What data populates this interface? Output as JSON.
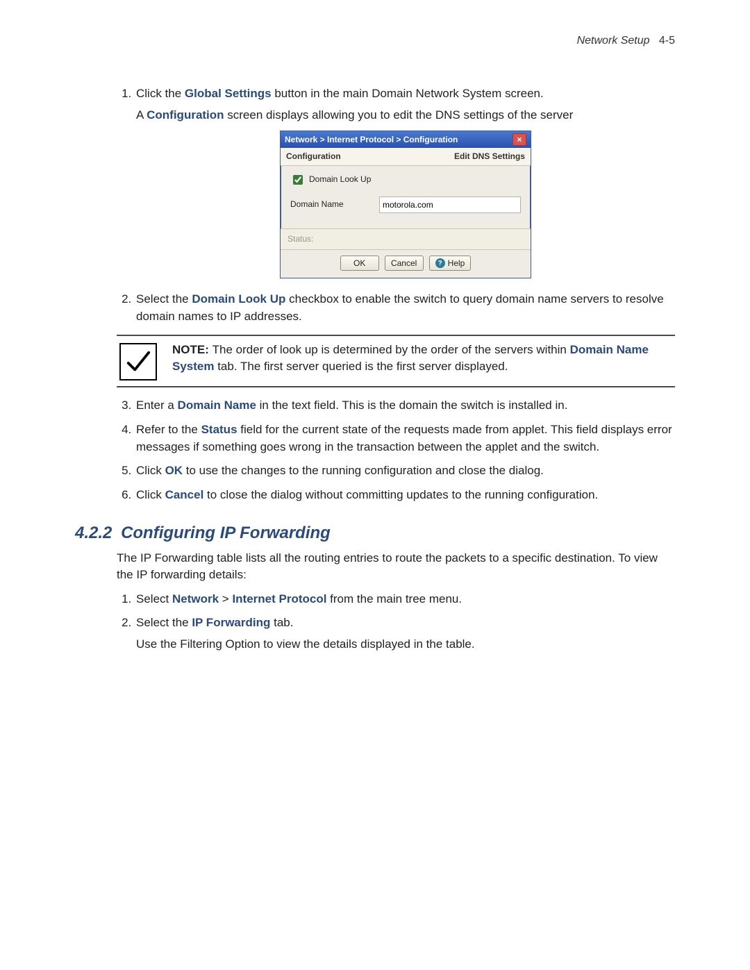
{
  "header": {
    "section": "Network Setup",
    "page": "4-5"
  },
  "steps_a": {
    "s1_pre": "Click the ",
    "s1_bold": "Global Settings",
    "s1_post": " button in the main Domain Network System screen.",
    "s1b_pre": "A ",
    "s1b_bold": "Configuration",
    "s1b_post": " screen displays allowing you to edit the DNS settings of the server"
  },
  "dialog": {
    "breadcrumb": "Network > Internet Protocol > Configuration",
    "tab_left": "Configuration",
    "tab_right": "Edit DNS Settings",
    "checkbox_label": "Domain Look Up",
    "field_label": "Domain Name",
    "field_value": "motorola.com",
    "status_label": "Status:",
    "btn_ok": "OK",
    "btn_cancel": "Cancel",
    "btn_help": "Help"
  },
  "steps_b": {
    "s2_pre": "Select the ",
    "s2_bold": "Domain Look Up",
    "s2_post": " checkbox to enable the switch to query domain name servers to resolve domain names to IP addresses."
  },
  "note": {
    "label": "NOTE: ",
    "text_pre": "The order of look up is determined by the order of the servers within ",
    "bold": "Domain Name System",
    "text_post": " tab. The first server queried is the first server displayed."
  },
  "steps_c": {
    "s3_pre": "Enter a ",
    "s3_bold": "Domain Name",
    "s3_post": " in the text field. This is the domain the switch is installed in.",
    "s4_pre": "Refer to the ",
    "s4_bold": "Status",
    "s4_post": " field for the current state of the requests made from applet. This field displays error messages if something goes wrong in the transaction between the applet and the switch.",
    "s5_pre": "Click ",
    "s5_bold": "OK",
    "s5_post": " to use the changes to the running configuration and close the dialog.",
    "s6_pre": "Click ",
    "s6_bold": "Cancel",
    "s6_post": " to close the dialog without committing updates to the running configuration."
  },
  "section2": {
    "number": "4.2.2",
    "title": "Configuring IP Forwarding",
    "para": "The IP Forwarding table lists all the routing entries to route the packets to a specific destination. To view the IP forwarding details:",
    "s1_pre": "Select ",
    "s1_bold1": "Network",
    "s1_mid": " > ",
    "s1_bold2": "Internet Protocol",
    "s1_post": " from the main tree menu.",
    "s2_pre": "Select the ",
    "s2_bold": "IP Forwarding",
    "s2_post": " tab.",
    "s2b": "Use the Filtering Option to view the details displayed in the table."
  }
}
